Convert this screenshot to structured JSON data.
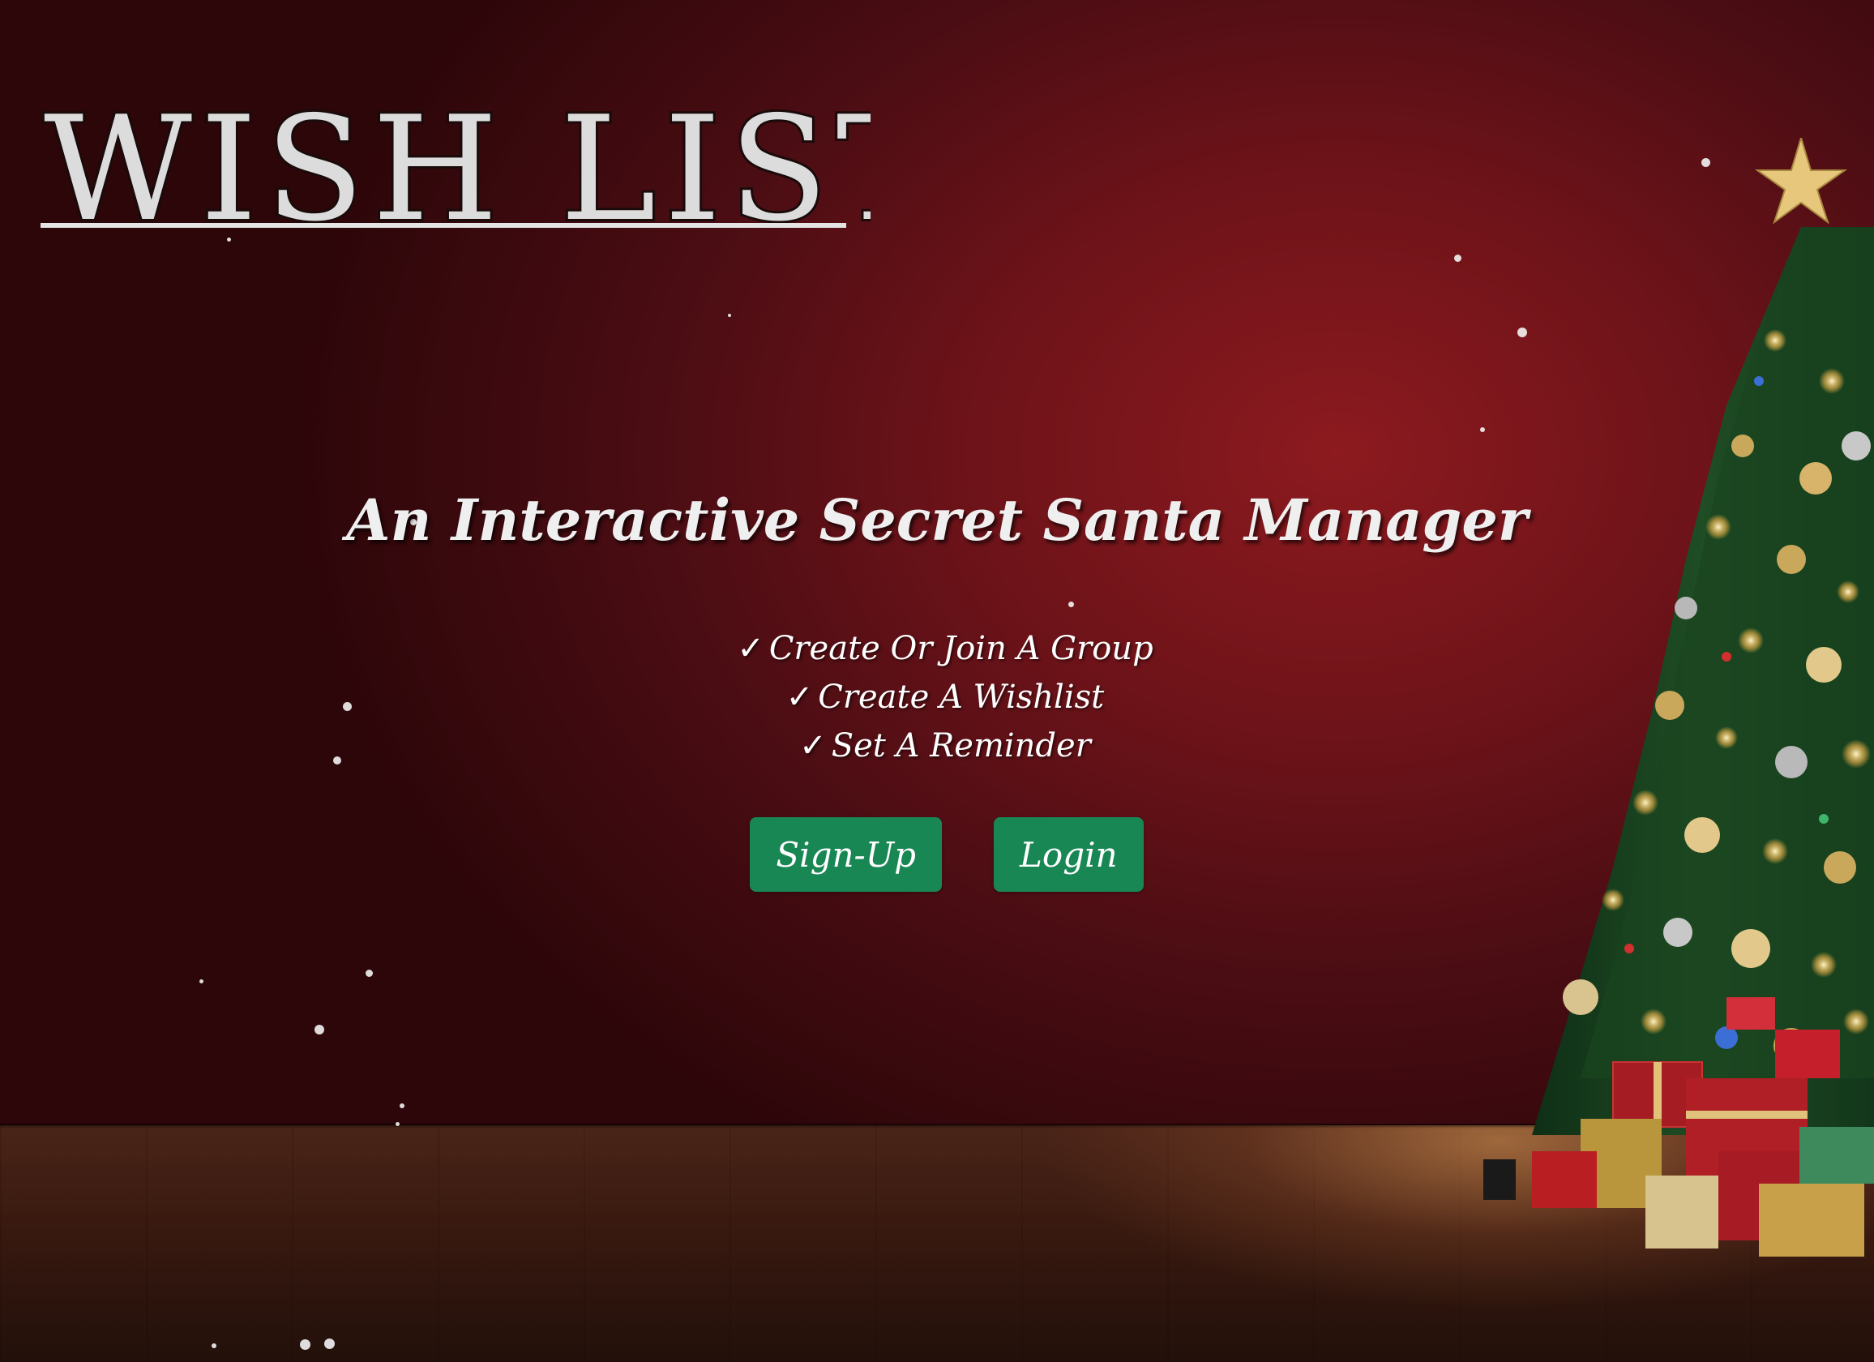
{
  "app": {
    "logo_text": "WISH LIST"
  },
  "hero": {
    "tagline": "An Interactive Secret Santa Manager",
    "features": [
      {
        "check": "✓",
        "label": "Create Or Join A Group"
      },
      {
        "check": "✓",
        "label": "Create A Wishlist"
      },
      {
        "check": "✓",
        "label": "Set A Reminder"
      }
    ]
  },
  "actions": {
    "signup_label": "Sign-Up",
    "login_label": "Login"
  },
  "colors": {
    "background_red": "#6d1319",
    "button_green": "#198754",
    "text_light": "#efefef"
  },
  "icons": {
    "feature_check": "checkmark-icon",
    "christmas_tree": "christmas-tree-illustration"
  }
}
